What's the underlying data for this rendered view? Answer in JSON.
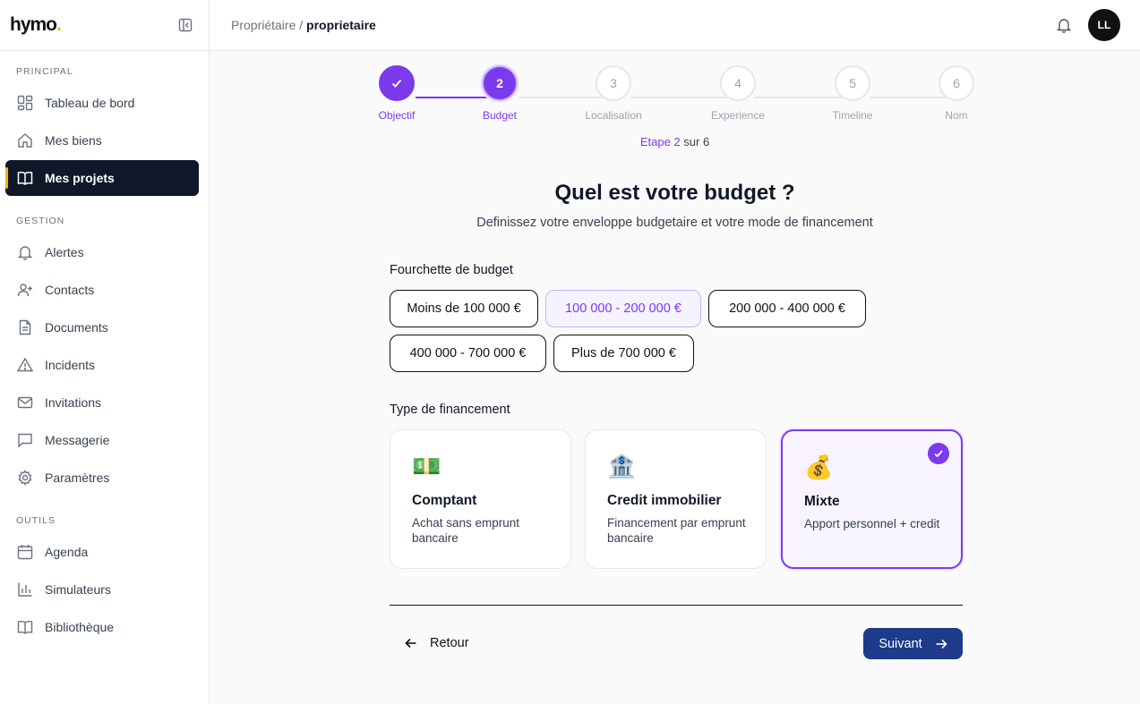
{
  "app": {
    "logo_text": "hymo",
    "logo_dot": "."
  },
  "sidebar": {
    "sections": [
      {
        "title": "PRINCIPAL",
        "items": [
          {
            "label": "Tableau de bord",
            "icon": "dashboard-icon"
          },
          {
            "label": "Mes biens",
            "icon": "home-icon"
          },
          {
            "label": "Mes projets",
            "icon": "book-icon",
            "active": true
          }
        ]
      },
      {
        "title": "GESTION",
        "items": [
          {
            "label": "Alertes",
            "icon": "bell-icon"
          },
          {
            "label": "Contacts",
            "icon": "user-plus-icon"
          },
          {
            "label": "Documents",
            "icon": "document-icon"
          },
          {
            "label": "Incidents",
            "icon": "warning-icon"
          },
          {
            "label": "Invitations",
            "icon": "mail-icon"
          },
          {
            "label": "Messagerie",
            "icon": "chat-icon"
          },
          {
            "label": "Paramètres",
            "icon": "gear-icon"
          }
        ]
      },
      {
        "title": "OUTILS",
        "items": [
          {
            "label": "Agenda",
            "icon": "calendar-icon"
          },
          {
            "label": "Simulateurs",
            "icon": "bar-chart-icon"
          },
          {
            "label": "Bibliothèque",
            "icon": "book-open-icon"
          }
        ]
      }
    ]
  },
  "topbar": {
    "breadcrumb_parent": "Propriétaire",
    "breadcrumb_sep": " / ",
    "breadcrumb_current": "proprietaire",
    "avatar_initials": "LL"
  },
  "stepper": {
    "steps": [
      {
        "number": "1",
        "label": "Objectif",
        "state": "done"
      },
      {
        "number": "2",
        "label": "Budget",
        "state": "current"
      },
      {
        "number": "3",
        "label": "Localisation",
        "state": "todo"
      },
      {
        "number": "4",
        "label": "Experience",
        "state": "todo"
      },
      {
        "number": "5",
        "label": "Timeline",
        "state": "todo"
      },
      {
        "number": "6",
        "label": "Nom",
        "state": "todo"
      }
    ],
    "count_prefix": "Etape 2",
    "count_suffix": " sur 6"
  },
  "form": {
    "title": "Quel est votre budget ?",
    "subtitle": "Definissez votre enveloppe budgetaire et votre mode de financement",
    "budget_label": "Fourchette de budget",
    "budget_options": [
      {
        "label": "Moins de 100 000 €",
        "selected": false
      },
      {
        "label": "100 000 - 200 000 €",
        "selected": true
      },
      {
        "label": "200 000 - 400 000 €",
        "selected": false
      },
      {
        "label": "400 000 - 700 000 €",
        "selected": false
      },
      {
        "label": "Plus de 700 000 €",
        "selected": false
      }
    ],
    "financing_label": "Type de financement",
    "financing_options": [
      {
        "emoji": "💵",
        "title": "Comptant",
        "desc": "Achat sans emprunt bancaire",
        "selected": false
      },
      {
        "emoji": "🏦",
        "title": "Credit immobilier",
        "desc": "Financement par emprunt bancaire",
        "selected": false
      },
      {
        "emoji": "💰",
        "title": "Mixte",
        "desc": "Apport personnel + credit",
        "selected": true
      }
    ],
    "back_label": "Retour",
    "next_label": "Suivant"
  },
  "colors": {
    "accent": "#7c3aed",
    "primary_button": "#1e3a8a",
    "sidebar_active": "#0f1729",
    "logo_dot": "#f5b400"
  }
}
